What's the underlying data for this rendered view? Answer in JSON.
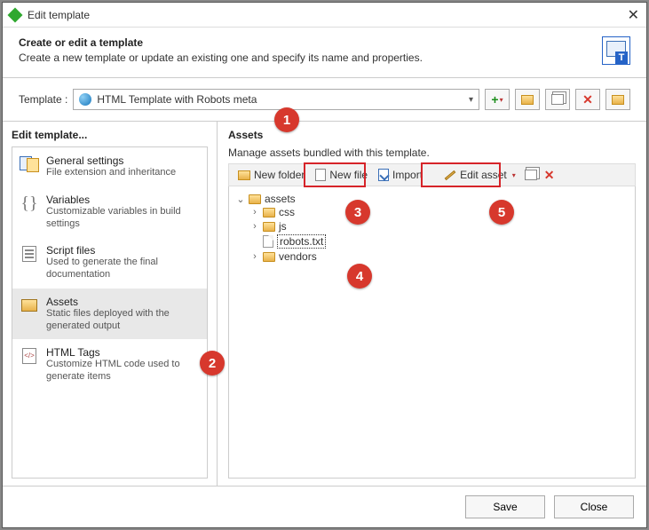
{
  "titlebar": {
    "title": "Edit template"
  },
  "header": {
    "heading": "Create or edit a template",
    "description": "Create a new template or update an existing one and specify its name and properties."
  },
  "template": {
    "label": "Template :",
    "selected": "HTML Template with Robots meta"
  },
  "sidebar": {
    "heading": "Edit template...",
    "items": [
      {
        "title": "General settings",
        "desc": "File extension and inheritance"
      },
      {
        "title": "Variables",
        "desc": "Customizable variables in build settings"
      },
      {
        "title": "Script files",
        "desc": "Used to generate the final documentation"
      },
      {
        "title": "Assets",
        "desc": "Static files deployed with the generated output"
      },
      {
        "title": "HTML Tags",
        "desc": "Customize HTML code used to generate items"
      }
    ]
  },
  "assets": {
    "heading": "Assets",
    "subtitle": "Manage assets bundled with this template.",
    "toolbar": {
      "newFolder": "New folder",
      "newFile": "New file",
      "import": "Import",
      "editAsset": "Edit asset"
    },
    "tree": {
      "root": "assets",
      "children": [
        {
          "name": "css",
          "type": "folder"
        },
        {
          "name": "js",
          "type": "folder"
        },
        {
          "name": "robots.txt",
          "type": "file",
          "selected": true
        },
        {
          "name": "vendors",
          "type": "folder"
        }
      ]
    }
  },
  "footer": {
    "save": "Save",
    "close": "Close"
  },
  "callouts": {
    "1": "1",
    "2": "2",
    "3": "3",
    "4": "4",
    "5": "5"
  }
}
